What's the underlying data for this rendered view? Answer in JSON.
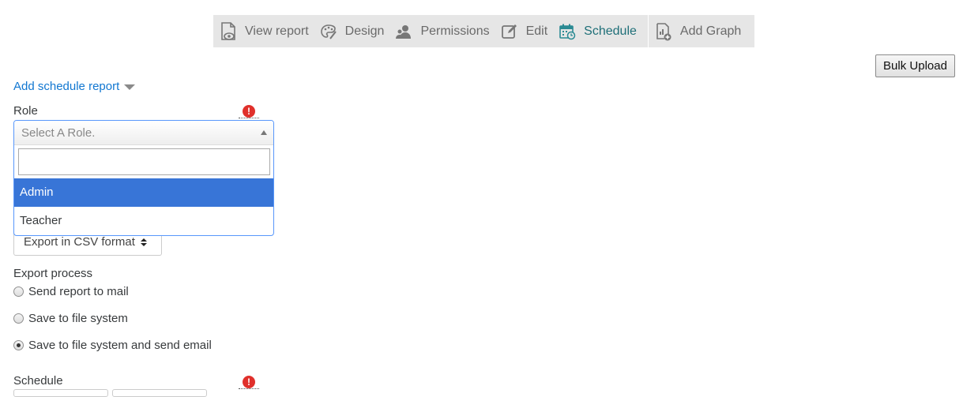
{
  "toolbar": {
    "items": [
      {
        "label": "View report",
        "icon": "view-report-icon"
      },
      {
        "label": "Design",
        "icon": "design-palette-icon"
      },
      {
        "label": "Permissions",
        "icon": "permissions-users-icon"
      },
      {
        "label": "Edit",
        "icon": "edit-pencil-icon"
      },
      {
        "label": "Schedule",
        "icon": "schedule-calendar-icon",
        "active": true
      },
      {
        "label": "Add Graph",
        "icon": "add-graph-icon"
      }
    ],
    "active_color": "#1f6f78"
  },
  "bulk_upload": {
    "label": "Bulk Upload"
  },
  "section": {
    "label": "Add schedule report"
  },
  "role": {
    "label": "Role",
    "required_icon": "!",
    "placeholder": "Select A Role.",
    "search_value": "",
    "options": [
      "Admin",
      "Teacher"
    ],
    "highlighted": "Admin"
  },
  "export_format": {
    "selected": "Export in CSV format"
  },
  "export_process": {
    "label": "Export process",
    "options": [
      {
        "label": "Send report to mail",
        "checked": false
      },
      {
        "label": "Save to file system",
        "checked": false
      },
      {
        "label": "Save to file system and send email",
        "checked": true
      }
    ]
  },
  "schedule": {
    "label": "Schedule",
    "required_icon": "!"
  },
  "colors": {
    "link": "#1177d1",
    "highlight": "#3875d7",
    "required": "#e0302b",
    "toolbar_bg": "#e6e6e6"
  }
}
